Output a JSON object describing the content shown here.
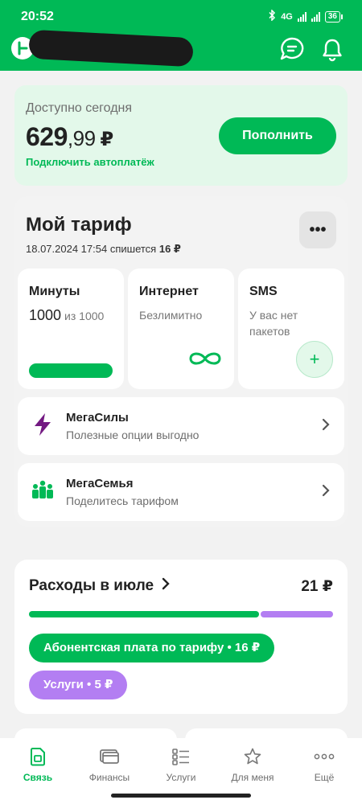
{
  "status_bar": {
    "time": "20:52",
    "network": "4G",
    "battery": "36"
  },
  "header": {
    "chat_icon": "chat-bubble-icon",
    "bell_icon": "bell-icon",
    "brand_color": "#00b956"
  },
  "balance": {
    "label": "Доступно сегодня",
    "amount_main": "629",
    "amount_cents": ",99",
    "currency": "₽",
    "autopay_link": "Подключить автоплатёж",
    "topup_button": "Пополнить"
  },
  "tariff": {
    "title": "Мой тариф",
    "date": "18.07.2024 17:54",
    "charge_text": "спишется",
    "charge_amount": "16 ₽",
    "more_label": "•••",
    "packages": [
      {
        "title": "Минуты",
        "value": "1000",
        "of_text": "из 1000",
        "remaining_fraction": 1.0
      },
      {
        "title": "Интернет",
        "value": "Безлимитно"
      },
      {
        "title": "SMS",
        "value": "У вас нет пакетов",
        "add_label": "+"
      }
    ]
  },
  "options": [
    {
      "title": "МегаСилы",
      "subtitle": "Полезные опции выгодно",
      "icon": "lightning-icon"
    },
    {
      "title": "МегаСемья",
      "subtitle": "Поделитесь тарифом",
      "icon": "family-icon"
    }
  ],
  "spending": {
    "title": "Расходы в июле",
    "total": "21 ₽",
    "segments": [
      {
        "label": "Абонентская плата по тарифу • 16 ₽",
        "amount": 16,
        "color": "#00b956"
      },
      {
        "label": "Услуги • 5 ₽",
        "amount": 5,
        "color": "#b37ef2"
      }
    ]
  },
  "bottom_nav": [
    {
      "label": "Связь",
      "icon": "sim-icon",
      "active": true
    },
    {
      "label": "Финансы",
      "icon": "card-icon",
      "active": false
    },
    {
      "label": "Услуги",
      "icon": "services-list-icon",
      "active": false
    },
    {
      "label": "Для меня",
      "icon": "star-icon",
      "active": false
    },
    {
      "label": "Ещё",
      "icon": "more-dots-icon",
      "active": false
    }
  ]
}
